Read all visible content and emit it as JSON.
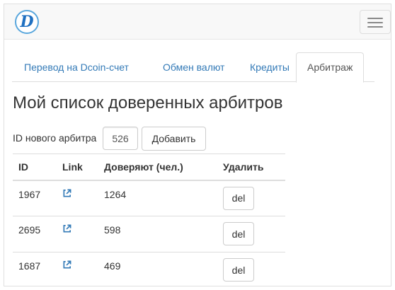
{
  "navbar": {
    "logo_letter": "D",
    "toggle_icon": "hamburger-menu-icon"
  },
  "tabs": [
    {
      "label": "Перевод на Dcoin-счет",
      "active": false
    },
    {
      "label": "Обмен валют",
      "active": false
    },
    {
      "label": "Кредиты",
      "active": false
    },
    {
      "label": "Арбитраж",
      "active": true
    }
  ],
  "page_title": "Мой список доверенных арбитров",
  "form": {
    "label": "ID нового арбитра",
    "input_value": "526",
    "add_button": "Добавить"
  },
  "table": {
    "headers": [
      "ID",
      "Link",
      "Доверяют (чел.)",
      "Удалить"
    ],
    "rows": [
      {
        "id": "1967",
        "link_icon": "external-link-icon",
        "trust": "1264",
        "delete": "del"
      },
      {
        "id": "2695",
        "link_icon": "external-link-icon",
        "trust": "598",
        "delete": "del"
      },
      {
        "id": "1687",
        "link_icon": "external-link-icon",
        "trust": "469",
        "delete": "del"
      }
    ]
  },
  "colors": {
    "link": "#337ab7",
    "navbar_bg": "#f8f8f8",
    "border": "#dddddd"
  }
}
